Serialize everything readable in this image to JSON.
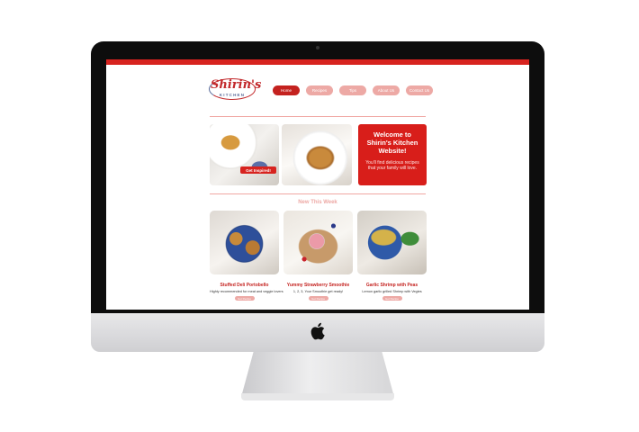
{
  "site": {
    "logo": {
      "script_text": "Shirin's",
      "sub_text": "KITCHEN"
    },
    "nav": [
      {
        "label": "Home",
        "active": true
      },
      {
        "label": "Recipes",
        "active": false
      },
      {
        "label": "Tips",
        "active": false
      },
      {
        "label": "About Us",
        "active": false
      },
      {
        "label": "Contact Us",
        "active": false
      }
    ],
    "hero": {
      "cta_label": "Get Inspired!",
      "welcome_title": "Welcome to Shirin's Kitchen Website!",
      "welcome_text": "You'll find delicious recipes that your family will love."
    },
    "section_title": "New This Week",
    "cards": [
      {
        "title": "Stuffed Deli Portobello",
        "desc": "Highly recommended for meat and veggie lovers",
        "button": "Get Recipe"
      },
      {
        "title": "Yummy Strawberry Smoothie",
        "desc": "1, 2, 3, Your Smoothie get ready!",
        "button": "Get Recipe"
      },
      {
        "title": "Garlic Shrimp with Peas",
        "desc": "Lemon garlic grilled Shrimp with Vegies",
        "button": "Get Recipe"
      }
    ]
  },
  "colors": {
    "brand_red": "#d7231f",
    "nav_pink": "#eda9a5",
    "nav_active": "#c4221f"
  },
  "icons": {
    "device_logo": "apple-icon"
  }
}
